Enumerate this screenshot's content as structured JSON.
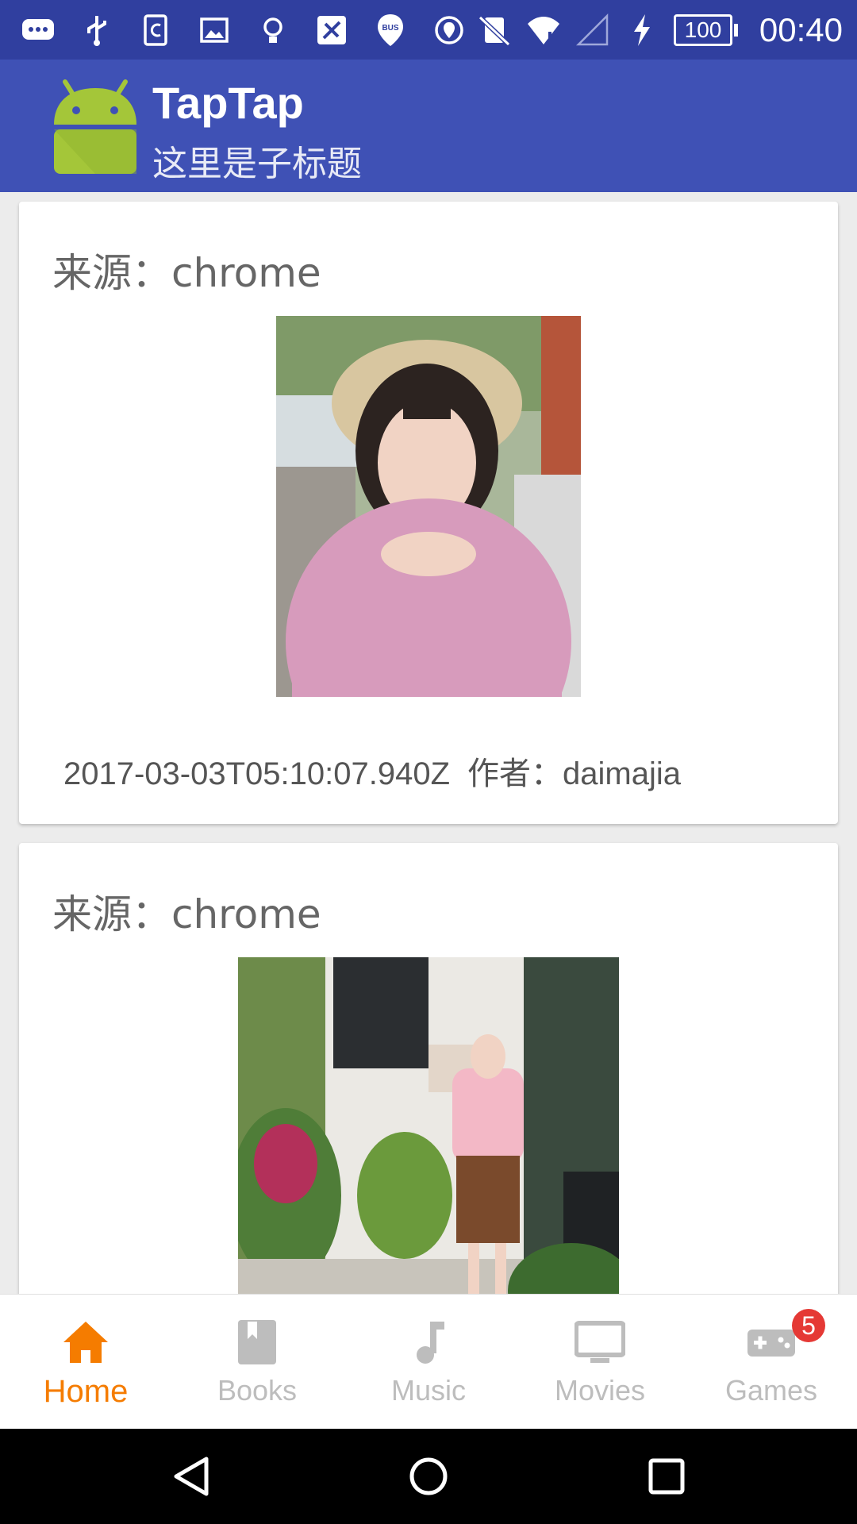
{
  "status_bar": {
    "time": "00:40",
    "battery": "100",
    "left_icons": [
      "chat-icon",
      "usb-icon",
      "clipboard-icon",
      "image-icon",
      "bulb-icon",
      "app-icon",
      "bus-icon",
      "location-shield-icon"
    ],
    "right_icons": [
      "no-notification-icon",
      "wifi-icon",
      "signal-icon",
      "charging-icon"
    ]
  },
  "app_bar": {
    "title": "TapTap",
    "subtitle": "这里是子标题",
    "background": "#3f51b5",
    "status_background": "#303f9f"
  },
  "feed": {
    "items": [
      {
        "source": "来源：chrome",
        "timestamp": "2017-03-03T05:10:07.940Z",
        "author": "作者：daimajia",
        "image": "photo-girl-straw-hat"
      },
      {
        "source": "来源：chrome",
        "image": "photo-girl-plants-storefront"
      }
    ]
  },
  "bottom_nav": {
    "active_color": "#f57c00",
    "inactive_color": "#bdbdbd",
    "items": [
      {
        "label": "Home",
        "icon": "home-icon",
        "active": true
      },
      {
        "label": "Books",
        "icon": "book-icon",
        "active": false
      },
      {
        "label": "Music",
        "icon": "music-note-icon",
        "active": false
      },
      {
        "label": "Movies",
        "icon": "tv-icon",
        "active": false
      },
      {
        "label": "Games",
        "icon": "gamepad-icon",
        "active": false,
        "badge": "5"
      }
    ]
  },
  "system_nav": {
    "buttons": [
      "back-icon",
      "home-circle-icon",
      "recents-icon"
    ]
  }
}
